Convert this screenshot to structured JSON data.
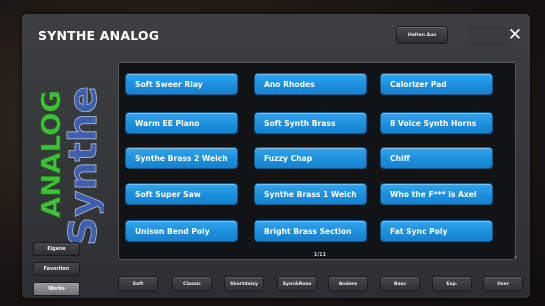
{
  "window": {
    "title": "SYNTHE ANALOG",
    "hold_button_label": "Halten Aus",
    "close_label": "✕"
  },
  "logo": {
    "word1": "ANALOG",
    "word2": "Synthe"
  },
  "sounds": [
    [
      "Soft Sweer Rlay",
      "Ano Rhodes",
      "Calorizer Pad"
    ],
    [
      "Warm EE Piano",
      "Soft Synth Brass",
      "8 Voice Synth Horns"
    ],
    [
      "Synthe Brass 2 Weich",
      "Fuzzy Chap",
      "Chiff"
    ],
    [
      "Soft Super Saw",
      "Synthe Brass 1 Weich",
      "Who the F*** is Axel"
    ],
    [
      "Unison Bend Poly",
      "Bright Brass Section",
      "Fat Sync Poly"
    ]
  ],
  "pager": "1/11",
  "side_buttons": [
    "Eigene",
    "Favoriten",
    "Works"
  ],
  "side_active_index": 2,
  "category_buttons": [
    "Soft",
    "Classic",
    "Shortdaisy",
    "Sync&Reso",
    "Andere",
    "Bass",
    "Exp.",
    "User"
  ],
  "colors": {
    "tile_blue": "#1d8edc",
    "logo_green": "#3fbf3a",
    "logo_blue": "#3d5fae"
  }
}
